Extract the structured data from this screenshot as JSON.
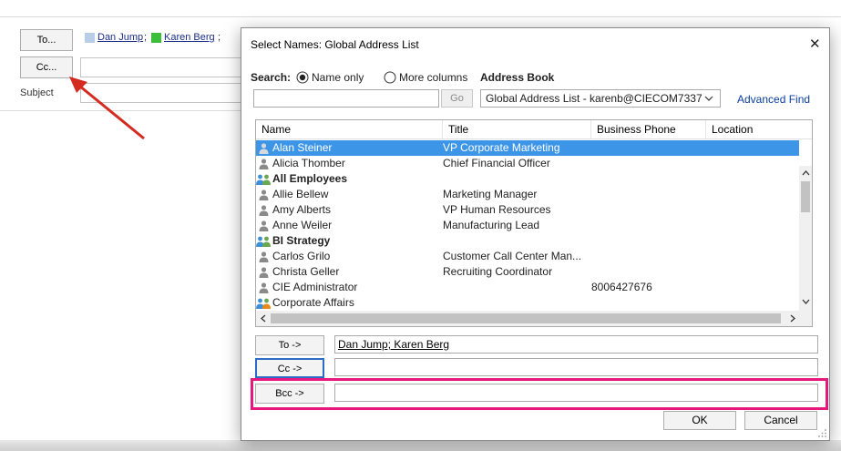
{
  "mail": {
    "to_label": "To...",
    "cc_label": "Cc...",
    "subject_label": "Subject",
    "recipients": [
      {
        "name": "Dan Jump",
        "sep": ";",
        "color": "#b8cde8"
      },
      {
        "name": "Karen Berg",
        "sep": ";",
        "color": "#3bbf3b"
      }
    ]
  },
  "dialog": {
    "title": "Select Names: Global Address List",
    "close_glyph": "✕",
    "search_label": "Search:",
    "radio_name_only": "Name only",
    "radio_more_columns": "More columns",
    "address_book_label": "Address Book",
    "search_value": "",
    "go_label": "Go",
    "address_book_value": "Global Address List - karenb@CIECOM7337",
    "advanced_find": "Advanced Find",
    "columns": [
      "Name",
      "Title",
      "Business Phone",
      "Location"
    ],
    "rows": [
      {
        "name": "Alan Steiner",
        "title": "VP Corporate Marketing",
        "phone": "",
        "type": "person",
        "selected": true
      },
      {
        "name": "Alicia Thomber",
        "title": "Chief Financial Officer",
        "phone": "",
        "type": "person"
      },
      {
        "name": "All Employees",
        "title": "",
        "phone": "",
        "type": "group"
      },
      {
        "name": "Allie Bellew",
        "title": "Marketing Manager",
        "phone": "",
        "type": "person"
      },
      {
        "name": "Amy Alberts",
        "title": "VP Human Resources",
        "phone": "",
        "type": "person"
      },
      {
        "name": "Anne Weiler",
        "title": "Manufacturing Lead",
        "phone": "",
        "type": "person"
      },
      {
        "name": "BI Strategy",
        "title": "",
        "phone": "",
        "type": "group"
      },
      {
        "name": "Carlos Grilo",
        "title": "Customer Call Center Man...",
        "phone": "",
        "type": "person"
      },
      {
        "name": "Christa Geller",
        "title": "Recruiting Coordinator",
        "phone": "",
        "type": "person"
      },
      {
        "name": "CIE Administrator",
        "title": "",
        "phone": "8006427676",
        "type": "person"
      },
      {
        "name": "Corporate Affairs",
        "title": "",
        "phone": "",
        "type": "group-orange"
      }
    ],
    "to_button": "To ->",
    "cc_button": "Cc ->",
    "bcc_button": "Bcc ->",
    "to_value": "Dan Jump; Karen Berg",
    "cc_value": "",
    "bcc_value": "",
    "ok_label": "OK",
    "cancel_label": "Cancel"
  },
  "colors": {
    "selection": "#3d95e8",
    "highlight_box": "#e8177d",
    "arrow": "#d42a20",
    "link": "#0a3fa0"
  }
}
